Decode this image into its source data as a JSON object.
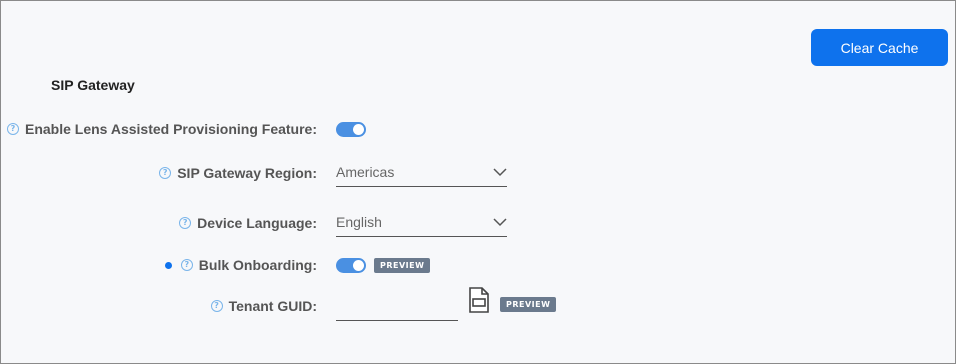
{
  "header": {
    "clear_cache_label": "Clear Cache"
  },
  "section": {
    "title": "SIP Gateway"
  },
  "fields": {
    "lens": {
      "label": "Enable Lens Assisted Provisioning Feature:",
      "enabled": true
    },
    "region": {
      "label": "SIP Gateway Region:",
      "value": "Americas"
    },
    "language": {
      "label": "Device Language:",
      "value": "English"
    },
    "bulk": {
      "label": "Bulk Onboarding:",
      "enabled": true,
      "badge": "PREVIEW"
    },
    "tenant": {
      "label": "Tenant GUID:",
      "value": "",
      "badge": "PREVIEW"
    }
  },
  "icons": {
    "help": "question-circle-icon",
    "file": "file-icon",
    "chevron": "chevron-down-icon",
    "dot": "new-indicator-dot"
  },
  "colors": {
    "accent": "#0e72ed",
    "toggle": "#4a90e2",
    "badge": "#6b7a8d"
  }
}
